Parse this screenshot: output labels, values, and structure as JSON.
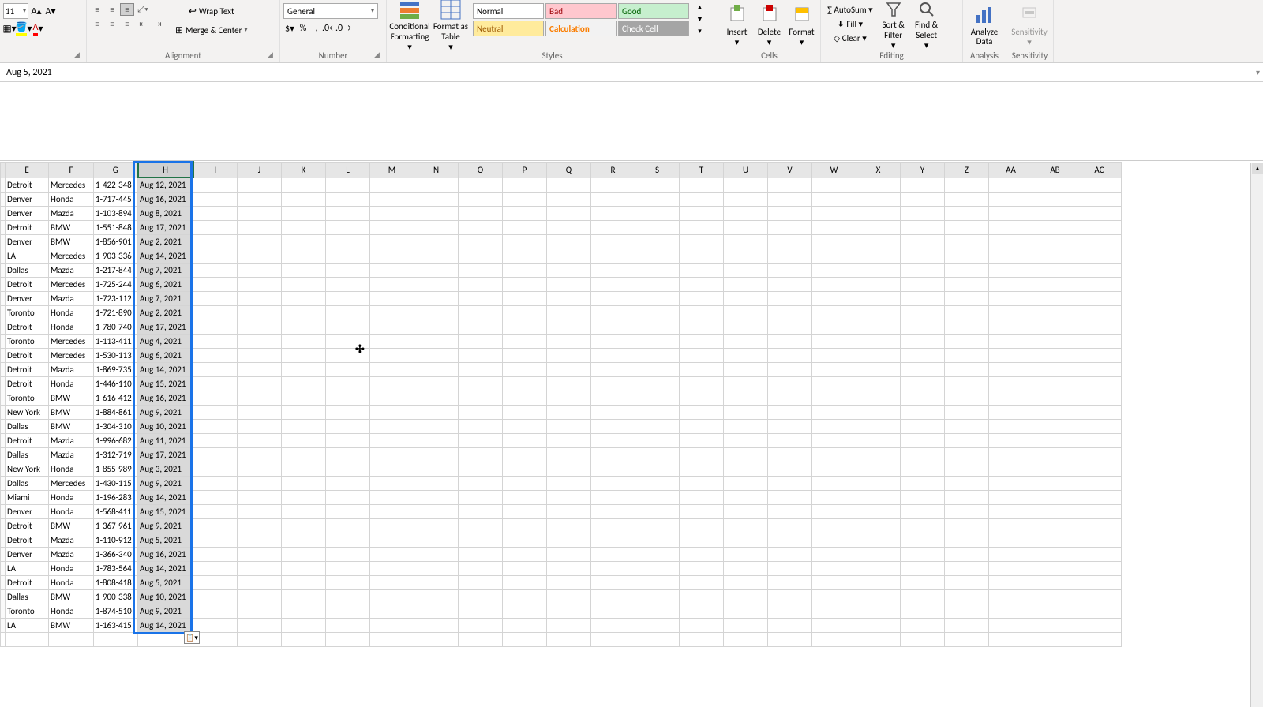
{
  "formula_bar": "Aug 5, 2021",
  "ribbon": {
    "font_size": "11",
    "wrap_text": "Wrap Text",
    "merge_center": "Merge & Center",
    "number_format": "General",
    "groups": {
      "alignment": "Alignment",
      "number": "Number",
      "styles": "Styles",
      "cells": "Cells",
      "editing": "Editing",
      "analysis": "Analysis",
      "sensitivity": "Sensitivity"
    },
    "buttons": {
      "conditional_formatting": "Conditional Formatting",
      "format_as_table": "Format as Table",
      "insert": "Insert",
      "delete": "Delete",
      "format": "Format",
      "autosum": "AutoSum",
      "fill": "Fill",
      "clear": "Clear",
      "sort_filter": "Sort & Filter",
      "find_select": "Find & Select",
      "analyze_data": "Analyze Data",
      "sensitivity": "Sensitivity"
    },
    "styles": {
      "normal": "Normal",
      "bad": "Bad",
      "good": "Good",
      "neutral": "Neutral",
      "calculation": "Calculation",
      "check_cell": "Check Cell"
    }
  },
  "columns": [
    "E",
    "F",
    "G",
    "H",
    "I",
    "J",
    "K",
    "L",
    "M",
    "N",
    "O",
    "P",
    "Q",
    "R",
    "S",
    "T",
    "U",
    "V",
    "W",
    "X",
    "Y",
    "Z",
    "AA",
    "AB",
    "AC"
  ],
  "selected_column": "H",
  "rows": [
    {
      "e": "Detroit",
      "f": "Mercedes",
      "g": "1-422-348",
      "h": "Aug 12, 2021"
    },
    {
      "e": "Denver",
      "f": "Honda",
      "g": "1-717-445",
      "h": "Aug 16, 2021"
    },
    {
      "e": "Denver",
      "f": "Mazda",
      "g": "1-103-894",
      "h": "Aug 8, 2021"
    },
    {
      "e": "Detroit",
      "f": "BMW",
      "g": "1-551-848",
      "h": "Aug 17, 2021"
    },
    {
      "e": "Denver",
      "f": "BMW",
      "g": "1-856-901",
      "h": "Aug 2, 2021"
    },
    {
      "e": "LA",
      "f": "Mercedes",
      "g": "1-903-336",
      "h": "Aug 14, 2021"
    },
    {
      "e": "Dallas",
      "f": "Mazda",
      "g": "1-217-844",
      "h": "Aug 7, 2021"
    },
    {
      "e": "Detroit",
      "f": "Mercedes",
      "g": "1-725-244",
      "h": "Aug 6, 2021"
    },
    {
      "e": "Denver",
      "f": "Mazda",
      "g": "1-723-112",
      "h": "Aug 7, 2021"
    },
    {
      "e": "Toronto",
      "f": "Honda",
      "g": "1-721-890",
      "h": "Aug 2, 2021"
    },
    {
      "e": "Detroit",
      "f": "Honda",
      "g": "1-780-740",
      "h": "Aug 17, 2021"
    },
    {
      "e": "Toronto",
      "f": "Mercedes",
      "g": "1-113-411",
      "h": "Aug 4, 2021"
    },
    {
      "e": "Detroit",
      "f": "Mercedes",
      "g": "1-530-113",
      "h": "Aug 6, 2021"
    },
    {
      "e": "Detroit",
      "f": "Mazda",
      "g": "1-869-735",
      "h": "Aug 14, 2021"
    },
    {
      "e": "Detroit",
      "f": "Honda",
      "g": "1-446-110",
      "h": "Aug 15, 2021"
    },
    {
      "e": "Toronto",
      "f": "BMW",
      "g": "1-616-412",
      "h": "Aug 16, 2021"
    },
    {
      "e": "New York",
      "f": "BMW",
      "g": "1-884-861",
      "h": "Aug 9, 2021"
    },
    {
      "e": "Dallas",
      "f": "BMW",
      "g": "1-304-310",
      "h": "Aug 10, 2021"
    },
    {
      "e": "Detroit",
      "f": "Mazda",
      "g": "1-996-682",
      "h": "Aug 11, 2021"
    },
    {
      "e": "Dallas",
      "f": "Mazda",
      "g": "1-312-719",
      "h": "Aug 17, 2021"
    },
    {
      "e": "New York",
      "f": "Honda",
      "g": "1-855-989",
      "h": "Aug 3, 2021"
    },
    {
      "e": "Dallas",
      "f": "Mercedes",
      "g": "1-430-115",
      "h": "Aug 9, 2021"
    },
    {
      "e": "Miami",
      "f": "Honda",
      "g": "1-196-283",
      "h": "Aug 14, 2021"
    },
    {
      "e": "Denver",
      "f": "Honda",
      "g": "1-568-411",
      "h": "Aug 15, 2021"
    },
    {
      "e": "Detroit",
      "f": "BMW",
      "g": "1-367-961",
      "h": "Aug 9, 2021"
    },
    {
      "e": "Detroit",
      "f": "Mazda",
      "g": "1-110-912",
      "h": "Aug 5, 2021"
    },
    {
      "e": "Denver",
      "f": "Mazda",
      "g": "1-366-340",
      "h": "Aug 16, 2021"
    },
    {
      "e": "LA",
      "f": "Honda",
      "g": "1-783-564",
      "h": "Aug 14, 2021"
    },
    {
      "e": "Detroit",
      "f": "Honda",
      "g": "1-808-418",
      "h": "Aug 5, 2021"
    },
    {
      "e": "Dallas",
      "f": "BMW",
      "g": "1-900-338",
      "h": "Aug 10, 2021"
    },
    {
      "e": "Toronto",
      "f": "Honda",
      "g": "1-874-510",
      "h": "Aug 9, 2021"
    },
    {
      "e": "LA",
      "f": "BMW",
      "g": "1-163-415",
      "h": "Aug 14, 2021"
    }
  ]
}
